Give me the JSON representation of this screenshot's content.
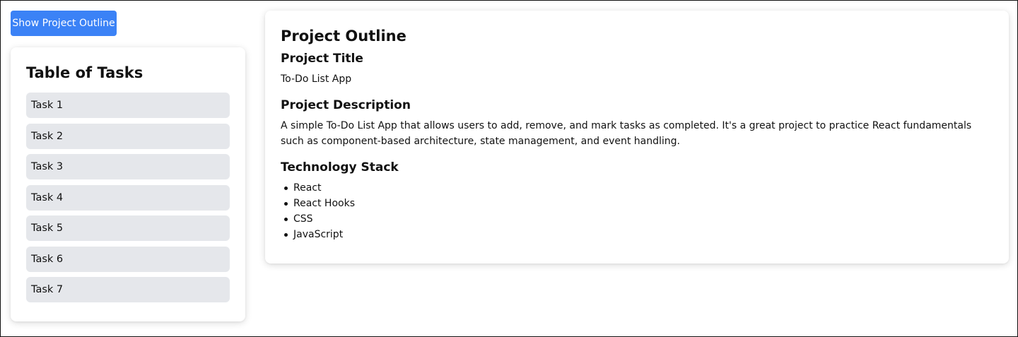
{
  "header": {
    "toggle_button_label": "Show Project Outline"
  },
  "tasks_panel": {
    "title": "Table of Tasks",
    "items": [
      {
        "label": "Task 1"
      },
      {
        "label": "Task 2"
      },
      {
        "label": "Task 3"
      },
      {
        "label": "Task 4"
      },
      {
        "label": "Task 5"
      },
      {
        "label": "Task 6"
      },
      {
        "label": "Task 7"
      }
    ]
  },
  "outline": {
    "title": "Project Outline",
    "project_title_heading": "Project Title",
    "project_title_value": "To-Do List App",
    "description_heading": "Project Description",
    "description_text": "A simple To-Do List App that allows users to add, remove, and mark tasks as completed. It's a great project to practice React fundamentals such as component-based architecture, state management, and event handling.",
    "tech_stack_heading": "Technology Stack",
    "tech_stack": [
      "React",
      "React Hooks",
      "CSS",
      "JavaScript"
    ]
  },
  "colors": {
    "accent": "#3b82f6",
    "task_item_bg": "#e5e7eb",
    "text": "#111111"
  }
}
